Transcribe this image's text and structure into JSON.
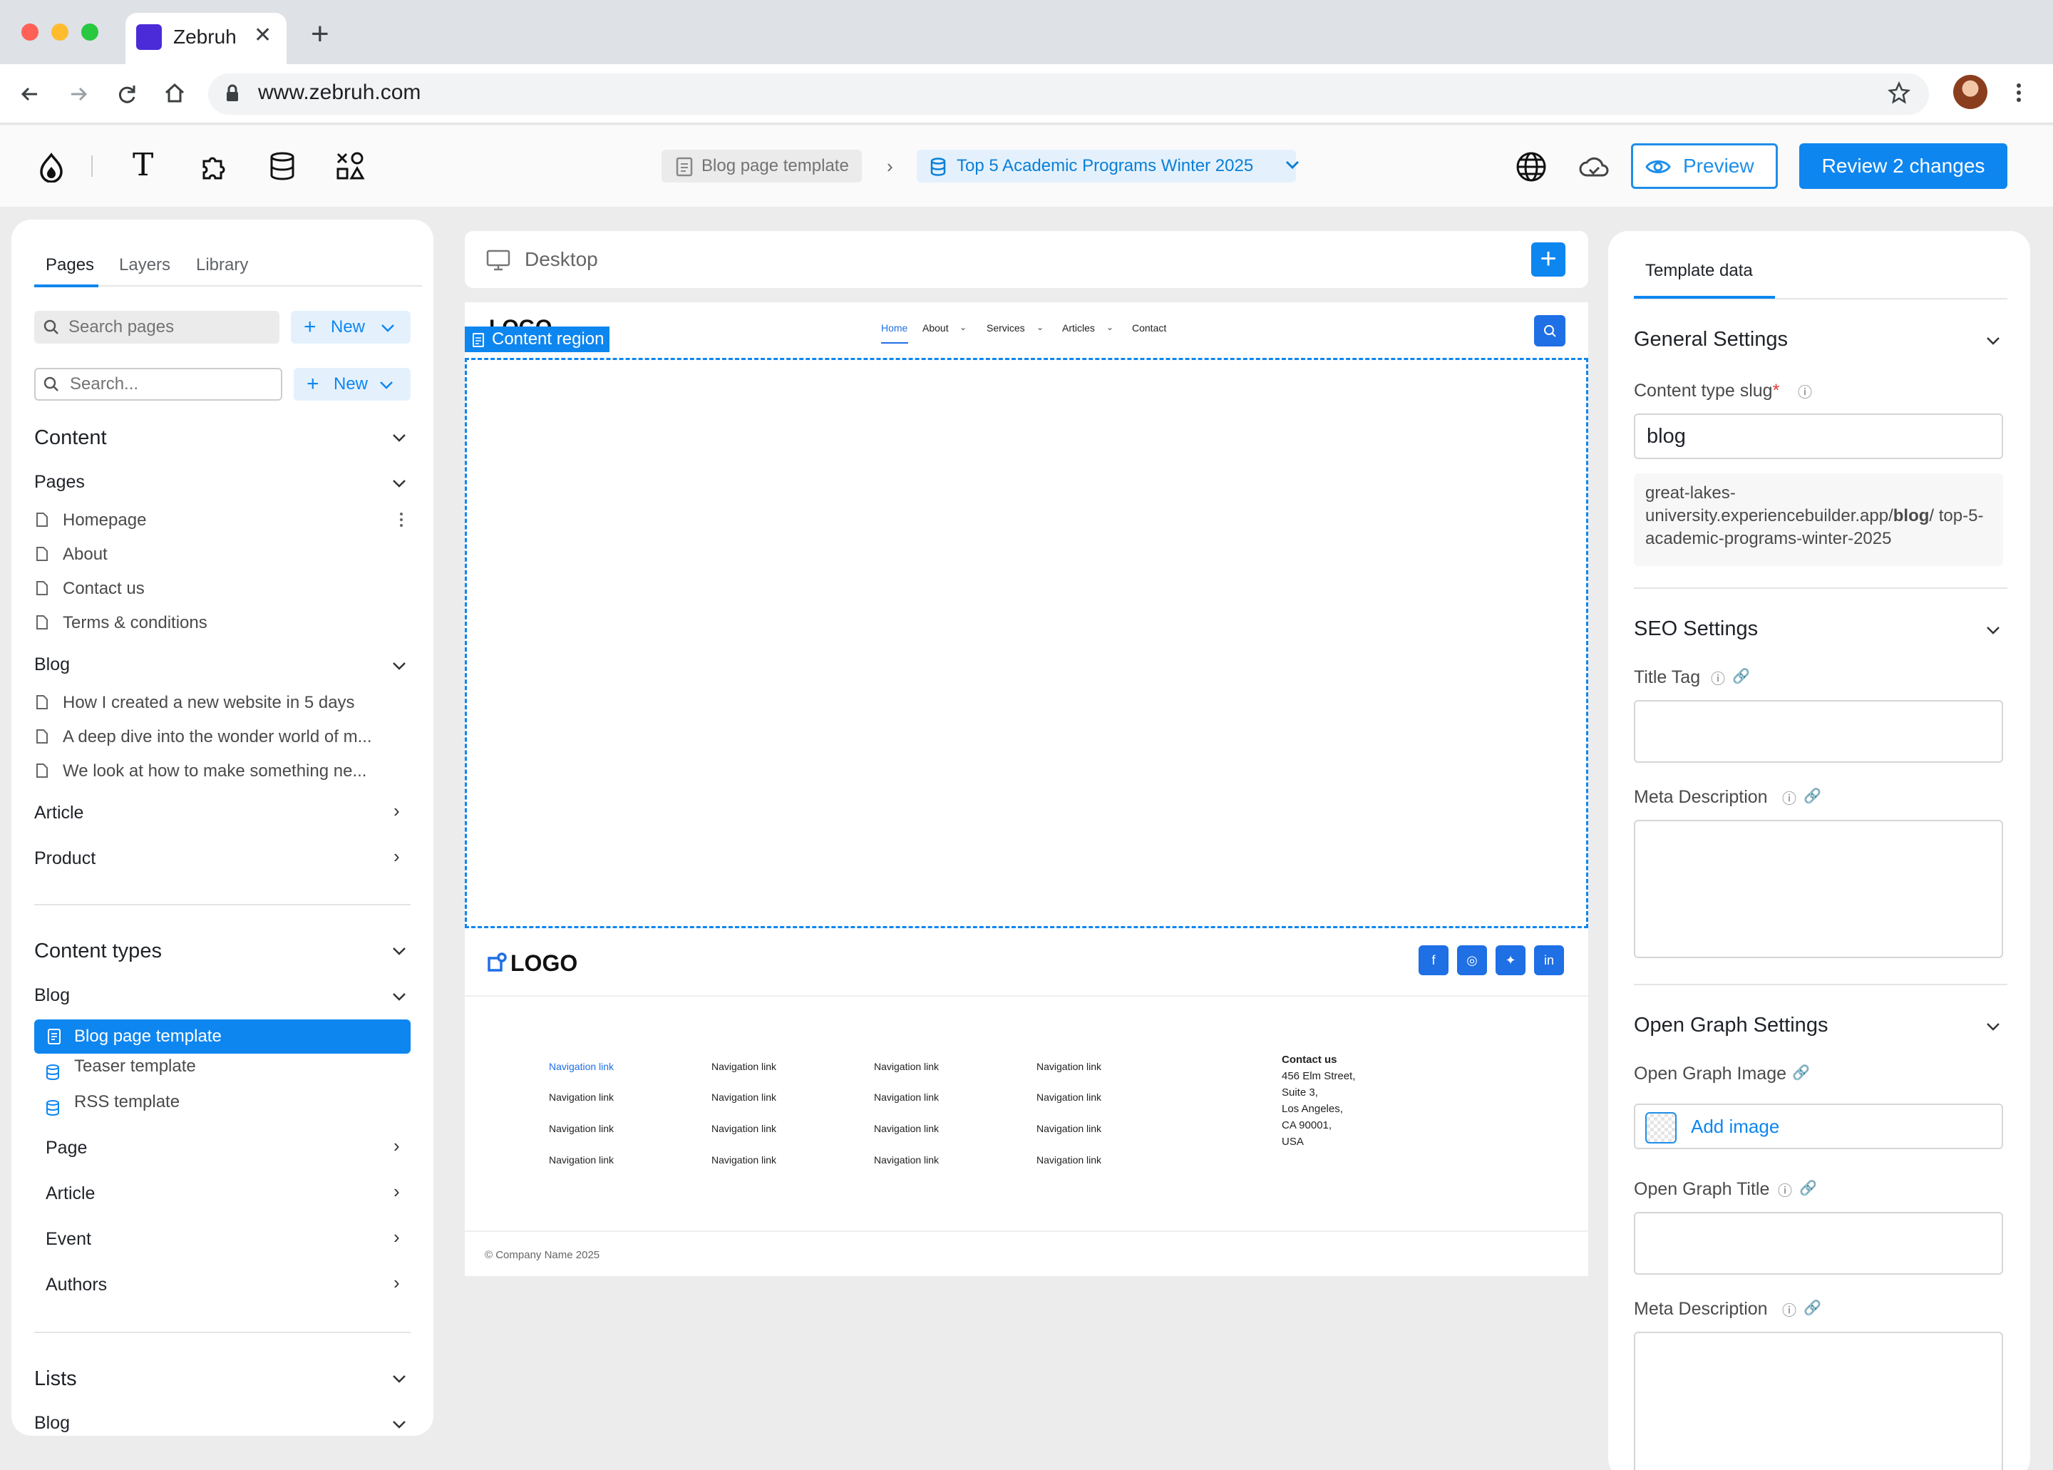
{
  "browser": {
    "tab_title": "Zebruh",
    "url": "www.zebruh.com"
  },
  "header": {
    "breadcrumb_template": "Blog page template",
    "breadcrumb_item": "Top 5 Academic Programs Winter 2025",
    "preview_label": "Preview",
    "review_label": "Review 2 changes"
  },
  "left": {
    "tabs": [
      "Pages",
      "Layers",
      "Library"
    ],
    "search1_placeholder": "Search pages",
    "search2_placeholder": "Search...",
    "new_label": "New",
    "content_heading": "Content",
    "pages_heading": "Pages",
    "pages": [
      "Homepage",
      "About",
      "Contact us",
      "Terms & conditions"
    ],
    "blog_heading": "Blog",
    "blog_posts": [
      "How I created a new website in 5 days",
      "A deep dive into the wonder world of m...",
      "We look at how to make something ne..."
    ],
    "article_label": "Article",
    "product_label": "Product",
    "content_types_heading": "Content types",
    "ct_blog": "Blog",
    "ct_blog_items": [
      "Blog page template",
      "Teaser template",
      "RSS template"
    ],
    "ct_groups": [
      "Page",
      "Article",
      "Event",
      "Authors"
    ],
    "lists_heading": "Lists",
    "lists_blog": "Blog"
  },
  "canvas": {
    "device": "Desktop",
    "content_region": "Content region",
    "logo_text": "LOGO",
    "nav": [
      "Home",
      "About",
      "Services",
      "Articles",
      "Contact"
    ],
    "footer_logo": "LOGO",
    "nav_link": "Navigation link",
    "contact_title": "Contact us",
    "contact_lines": [
      "456 Elm Street,",
      "Suite 3,",
      "Los Angeles,",
      "CA 90001,",
      "USA"
    ],
    "copyright": "© Company Name 2025"
  },
  "right": {
    "tab": "Template data",
    "general": "General Settings",
    "slug_label": "Content type slug",
    "slug_value": "blog",
    "url_prefix": "great-lakes-university.experiencebuilder.app/",
    "url_bold": "blog",
    "url_suffix": "/ top-5-academic-programs-winter-2025",
    "seo": "SEO Settings",
    "title_tag": "Title Tag",
    "meta_desc": "Meta Description",
    "og": "Open Graph Settings",
    "og_image": "Open Graph Image",
    "add_image": "Add image",
    "og_title": "Open Graph Title",
    "og_meta": "Meta Description"
  },
  "colors": {
    "accent": "#0e86f0",
    "canvas_blue": "#1f6fe5"
  }
}
